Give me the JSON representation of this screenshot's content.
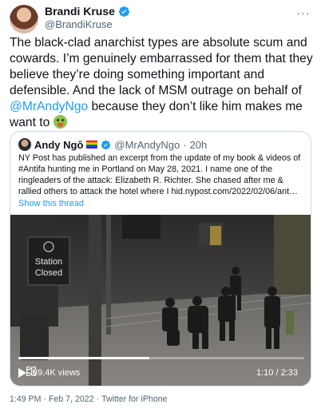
{
  "author": {
    "name": "Brandi Kruse",
    "handle": "@BrandiKruse",
    "more_label": "···"
  },
  "tweet": {
    "text_before": "The black-clad anarchist types are absolute scum and cowards. I’m genuinely embarrassed for them that they believe they’re doing something important and defensible. And the lack of MSM outrage on behalf of ",
    "mention": "@MrAndyNgo",
    "text_after": " because they don’t like him makes me want to ",
    "emoji_name": "nauseated-face-icon"
  },
  "quote": {
    "name": "Andy Ngô",
    "handle": "@MrAndyNgo",
    "separator": "·",
    "time": "20h",
    "text": "NY Post has published an excerpt from the update of my book & videos of #Antifa hunting me in Portland on May 28, 2021. I name one of the ringleaders of the attack: Elizabeth R. Richter. She chased after me & rallied others to attack the hotel where I hid.nypost.com/2022/02/06/ant…",
    "show_thread": "Show this thread",
    "video": {
      "sign_line1": "Station",
      "sign_line2": "Closed",
      "views": "89.4K views",
      "time": "1:10 / 2:33",
      "progress": 0.4575
    }
  },
  "footer": {
    "time": "1:49 PM",
    "sep1": "·",
    "date": "Feb 7, 2022",
    "sep2": "·",
    "source": "Twitter for iPhone"
  },
  "colors": {
    "link": "#1d9bf0",
    "secondary": "#536471",
    "border": "#cfd9de"
  }
}
